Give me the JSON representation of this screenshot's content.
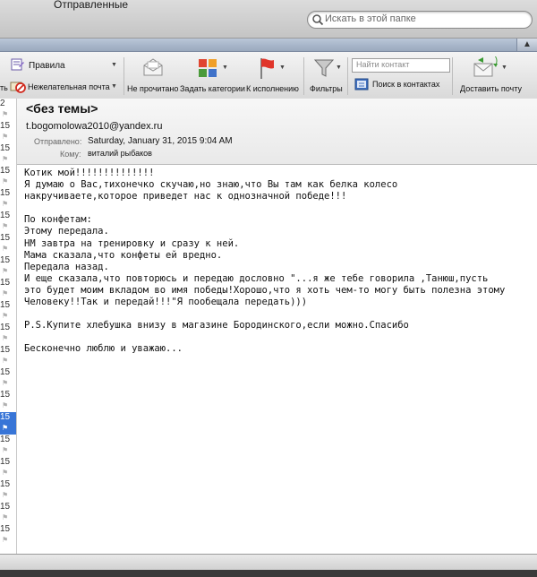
{
  "window": {
    "title": "Отправленные"
  },
  "search": {
    "placeholder": "Искать в этой папке"
  },
  "toolbar": {
    "rules_label": "Правила",
    "rules_left_fragment": "ть",
    "junk_label": "Нежелательная почта",
    "unread_label": "Не прочитано",
    "categories_label": "Задать категории",
    "followup_label": "К исполнению",
    "filters_label": "Фильтры",
    "find_contact_placeholder": "Найти контакт",
    "contact_search_label": "Поиск в контактах",
    "deliver_label": "Доставить почту"
  },
  "message_list": {
    "rows": [
      {
        "date": "2",
        "selected": false
      },
      {
        "date": "15",
        "selected": false
      },
      {
        "date": "15",
        "selected": false
      },
      {
        "date": "15",
        "selected": false
      },
      {
        "date": "15",
        "selected": false
      },
      {
        "date": "15",
        "selected": false
      },
      {
        "date": "15",
        "selected": false
      },
      {
        "date": "15",
        "selected": false
      },
      {
        "date": "15",
        "selected": false
      },
      {
        "date": "15",
        "selected": false
      },
      {
        "date": "15",
        "selected": false
      },
      {
        "date": "15",
        "selected": false
      },
      {
        "date": "15",
        "selected": false
      },
      {
        "date": "15",
        "selected": false
      },
      {
        "date": "15",
        "selected": true
      },
      {
        "date": "15",
        "selected": false
      },
      {
        "date": "15",
        "selected": false
      },
      {
        "date": "15",
        "selected": false
      },
      {
        "date": "15",
        "selected": false
      },
      {
        "date": "15",
        "selected": false
      }
    ]
  },
  "message": {
    "subject": "<без темы>",
    "from": "t.bogomolowa2010@yandex.ru",
    "sent_label": "Отправлено:",
    "sent_value": "Saturday, January 31, 2015 9:04 AM",
    "to_label": "Кому:",
    "to_value": "виталий рыбаков",
    "body": "Котик мой!!!!!!!!!!!!!!\nЯ думаю о Вас,тихонечко скучаю,но знаю,что Вы там как белка колесо\nнакручиваете,которое приведет нас к однозначной победе!!!\n\nПо конфетам:\nЭтому передала.\nНМ завтра на тренировку и сразу к ней.\nМама сказала,что конфеты ей вредно.\nПередала назад.\nИ еще сказала,что повторюсь и передаю дословно \"...я же тебе говорила ,Танюш,пусть\nэто будет моим вкладом во имя победы!Хорошо,что я хоть чем-то могу быть полезна этому\nЧеловеку!!Так и передай!!!\"Я пообещала передать)))\n\nP.S.Купите хлебушка внизу в магазине Бородинского,если можно.Спасибо\n\nБесконечно люблю и уважаю..."
  },
  "colors": {
    "selection": "#3875d7",
    "toolbar_bg": "#e6e6e6",
    "header_bg": "#f0f0f0"
  },
  "icons": {
    "search": "magnifier-icon",
    "rules": "rules-icon",
    "junk": "junk-mail-icon",
    "unread": "envelope-icon",
    "categories": "categories-icon",
    "followup": "flag-icon",
    "filters": "funnel-icon",
    "contacts": "address-book-icon",
    "deliver": "send-receive-icon",
    "collapse": "chevron-up-icon"
  }
}
